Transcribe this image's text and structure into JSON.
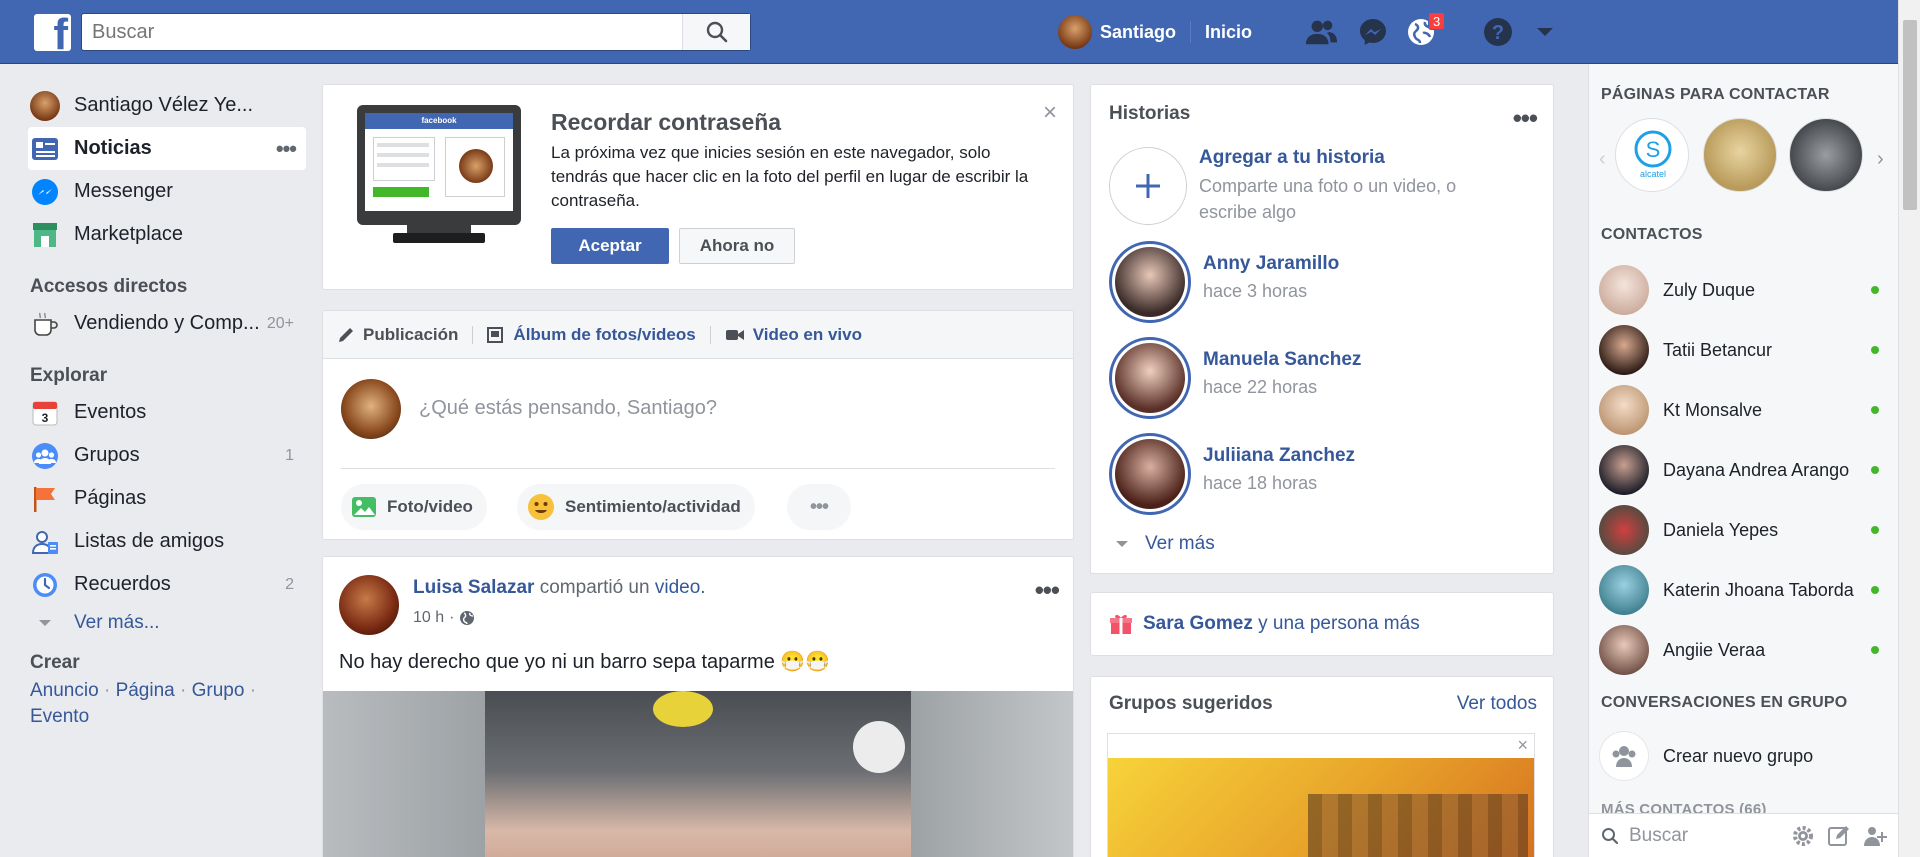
{
  "topbar": {
    "search_placeholder": "Buscar",
    "user_name": "Santiago",
    "home_label": "Inicio",
    "notification_count": "3"
  },
  "left_nav": {
    "profile_name": "Santiago Vélez Ye...",
    "main_items": [
      {
        "label": "Noticias",
        "icon": "news-feed-icon"
      },
      {
        "label": "Messenger",
        "icon": "messenger-icon"
      },
      {
        "label": "Marketplace",
        "icon": "marketplace-icon"
      }
    ],
    "shortcuts_heading": "Accesos directos",
    "shortcuts": [
      {
        "label": "Vendiendo y Comp...",
        "count": "20+",
        "icon": "coffee-cup-icon"
      }
    ],
    "explore_heading": "Explorar",
    "explore_items": [
      {
        "label": "Eventos",
        "count": "",
        "icon": "calendar-icon"
      },
      {
        "label": "Grupos",
        "count": "1",
        "icon": "groups-icon"
      },
      {
        "label": "Páginas",
        "count": "",
        "icon": "flag-icon"
      },
      {
        "label": "Listas de amigos",
        "count": "",
        "icon": "friend-list-icon"
      },
      {
        "label": "Recuerdos",
        "count": "2",
        "icon": "memories-icon"
      }
    ],
    "see_more": "Ver más...",
    "create_heading": "Crear",
    "create_links": [
      "Anuncio",
      "Página",
      "Grupo",
      "Evento"
    ]
  },
  "password_card": {
    "title": "Recordar contraseña",
    "text": "La próxima vez que inicies sesión en este navegador, solo tendrás que hacer clic en la foto del perfil en lugar de escribir la contraseña.",
    "accept_label": "Aceptar",
    "decline_label": "Ahora no",
    "illustration_brand": "facebook"
  },
  "composer": {
    "tabs": [
      "Publicación",
      "Álbum de fotos/videos",
      "Video en vivo"
    ],
    "placeholder": "¿Qué estás pensando, Santiago?",
    "actions": [
      "Foto/video",
      "Sentimiento/actividad"
    ]
  },
  "post": {
    "author": "Luisa Salazar",
    "action_text": "compartió un",
    "action_link": "video.",
    "time": "10 h",
    "text": "No hay derecho que yo ni un barro sepa taparme 😷😷"
  },
  "stories": {
    "title": "Historias",
    "add_title": "Agregar a tu historia",
    "add_subtitle": "Comparte una foto o un video, o escribe algo",
    "items": [
      {
        "name": "Anny Jaramillo",
        "time": "hace 3 horas"
      },
      {
        "name": "Manuela Sanchez",
        "time": "hace 22 horas"
      },
      {
        "name": "Juliiana Zanchez",
        "time": "hace 18 horas"
      }
    ],
    "see_more": "Ver más"
  },
  "birthday": {
    "name": "Sara Gomez",
    "rest": "y una persona más"
  },
  "groups": {
    "title": "Grupos sugeridos",
    "see_all": "Ver todos"
  },
  "sidebar": {
    "pages_heading": "PÁGINAS PARA CONTACTAR",
    "contacts_heading": "CONTACTOS",
    "contacts": [
      {
        "name": "Zuly Duque",
        "color": "#e6d2c8"
      },
      {
        "name": "Tatii Betancur",
        "color": "#4a2a20"
      },
      {
        "name": "Kt Monsalve",
        "color": "#d8b59a"
      },
      {
        "name": "Dayana Andrea Arango",
        "color": "#2e3140"
      },
      {
        "name": "Daniela Yepes",
        "color": "#8a6a5a"
      },
      {
        "name": "Katerin Jhoana Taborda",
        "color": "#6aa3b8"
      },
      {
        "name": "Angiie Veraa",
        "color": "#b89080"
      }
    ],
    "group_conv_heading": "CONVERSACIONES EN GRUPO",
    "create_group": "Crear nuevo grupo",
    "more_contacts": "MÁS CONTACTOS (66)",
    "search_placeholder": "Buscar"
  },
  "colors": {
    "brand_blue": "#4267b2",
    "link_blue": "#365899",
    "online_green": "#42b72a",
    "badge_red": "#fa3e3e"
  }
}
